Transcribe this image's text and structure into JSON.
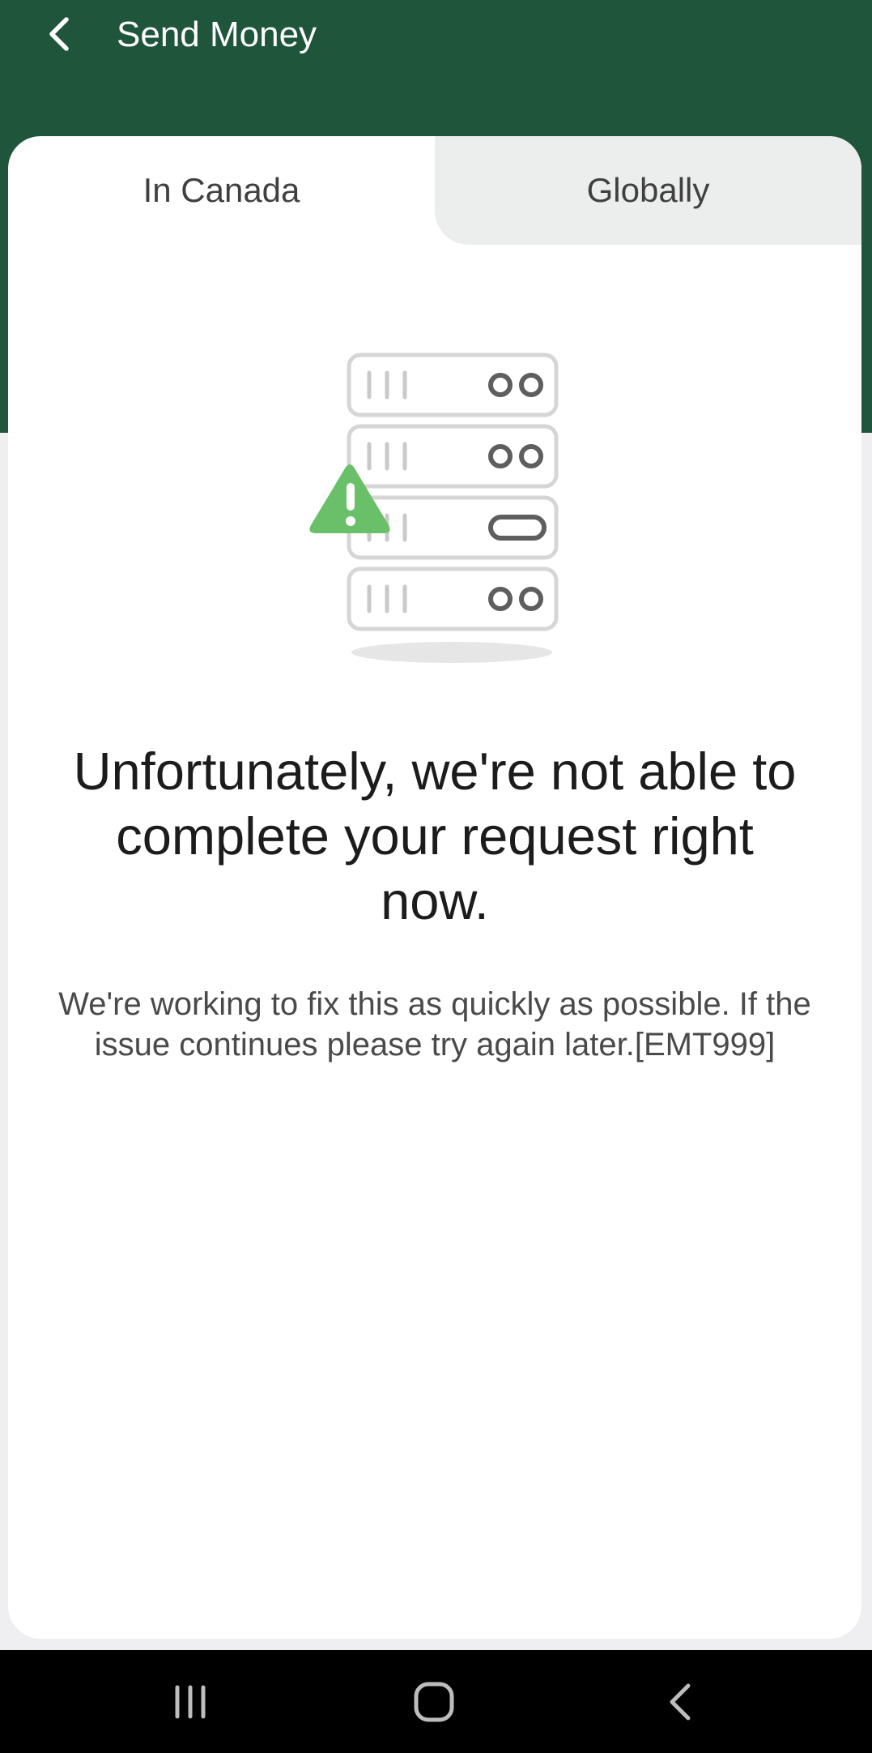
{
  "header": {
    "title": "Send Money",
    "back_icon": "chevron-left-icon",
    "background_color": "#1f553b"
  },
  "tabs": [
    {
      "label": "In Canada",
      "selected": true
    },
    {
      "label": "Globally",
      "selected": false
    }
  ],
  "error": {
    "illustration": "server-warning-icon",
    "accent_color": "#6abf69",
    "headline": "Unfortunately, we're not able to complete your request right now.",
    "message": "We're working to fix this as quickly as possible. If the issue continues please try again later.[EMT999]"
  },
  "system_nav": {
    "buttons": [
      "recent-apps-icon",
      "home-icon",
      "back-icon"
    ]
  }
}
